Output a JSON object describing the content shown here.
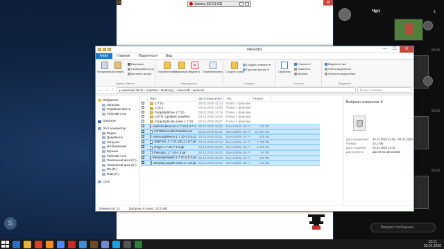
{
  "recording": {
    "label": "Запись [00:21:03]"
  },
  "explorer": {
    "title": "versions",
    "window_controls": {
      "minimize": "—",
      "maximize": "☐",
      "close": "✕"
    },
    "tabs": [
      "Файл",
      "Главная",
      "Поделиться",
      "Вид"
    ],
    "ribbon": {
      "copy": "Копировать",
      "paste": "Вставить",
      "cut": "Вырезать",
      "copy_path": "Скопировать путь",
      "paste_shortcut": "Вставить ярлык",
      "clipboard_group": "Буфер обмена",
      "move_to": "Переместить в",
      "copy_to": "Копировать в",
      "delete": "Удалить",
      "rename": "Переименовать",
      "organize_group": "Упорядочить",
      "new_folder": "Создать папку",
      "new_item": "Создать элемент ▾",
      "easy_access": "Простой доступ ▾",
      "create_group": "Создать",
      "properties": "Свойства",
      "open": "Открыть ▾",
      "edit": "Изменить",
      "history": "Журнал",
      "open_group": "Открыть",
      "select_all": "Выделить все",
      "select_none": "Снять выделение",
      "invert_selection": "Обратить выделение",
      "select_group": "Выделить"
    },
    "address": {
      "back": "←",
      "forward": "→",
      "up": "↑",
      "path": "▸ Никиткай Яков › AppData › Roaming › .minecraft › versions",
      "search_placeholder": "Поиск: versions"
    },
    "nav": [
      "Избранное",
      "Загрузки",
      "Недавние места",
      "Рабочий стол",
      "",
      "OneDrive",
      "",
      "Этот компьютер",
      "Видео",
      "Документы",
      "Загрузки",
      "Изображения",
      "Музыка",
      "Рабочий стол",
      "Локальный диск (C:)",
      "Локальный диск (D:)",
      "DS (E:)",
      "Data (F:)",
      "",
      "Сеть"
    ],
    "columns": [
      "Имя",
      "Дата изменения",
      "Тип",
      "Размер"
    ],
    "files": [
      {
        "name": "1.7.10",
        "date": "03.01.2020 12:13",
        "type": "Папка с файлами",
        "size": "",
        "kind": "folder",
        "selected": false
      },
      {
        "name": "1.15.1",
        "date": "03.01.2020 11:08",
        "type": "Папка с файлами",
        "size": "",
        "kind": "folder",
        "selected": false
      },
      {
        "name": "ForgeOptiFine 1.7.10",
        "date": "03.01.2020 12:15",
        "type": "Папка с файлами",
        "size": "",
        "kind": "folder",
        "selected": false
      },
      {
        "name": "LOTR_Updated_engFiles",
        "date": "03.12.2019 12:52",
        "type": "Папка с файлами",
        "size": "",
        "kind": "folder",
        "selected": false
      },
      {
        "name": "ForgeOptiLiteLoader 1.7.10",
        "date": "03.12.2019 19:27",
        "type": "Папка с файлами",
        "size": "",
        "kind": "folder",
        "selected": false
      },
      {
        "name": "codechickencore-1.7.10-1.0.7.47-univ...",
        "date": "28.10.2019 16:01",
        "type": "Executable Jar File",
        "size": "183 КБ",
        "kind": "jar",
        "selected": true
      },
      {
        "name": "LOTRMod-v35-Rebalum.jar",
        "date": "26.11.2019 11:25",
        "type": "Executable Jar File",
        "size": "21 254 КБ",
        "kind": "jar",
        "selected": true
      },
      {
        "name": "notenoughitems-1.7.10-1.0.5.120-univ...",
        "date": "28.10.2019 16:01",
        "type": "Executable Jar File",
        "size": "346 КБ",
        "kind": "jar",
        "selected": true
      },
      {
        "name": "OptiFine_1.7.10_HD_U_E7.jar",
        "date": "03.01.2020 12:14",
        "type": "Executable Jar File",
        "size": "1 798 КБ",
        "kind": "jar",
        "selected": true
      },
      {
        "name": "Origin-1.7.10-7.1.0.jar",
        "date": "26.10.2019 16:04",
        "type": "Executable Jar File",
        "size": "1 066 КБ",
        "kind": "jar",
        "selected": true
      },
      {
        "name": "thincaps_1.7.10-1.4.jar",
        "date": "26.10.2019 16:04",
        "type": "Executable Jar File",
        "size": "97 КБ",
        "kind": "jar",
        "selected": true
      },
      {
        "name": "WeepingAngels-1.7.10-4.0.2.jar",
        "date": "26.10.2019 16:04",
        "type": "Executable Jar File",
        "size": "253 КБ",
        "kind": "jar",
        "selected": true
      },
      {
        "name": "weeping-angels-mod-1.7.10.jar",
        "date": "03.01.2020 12:02",
        "type": "Executable Jar File",
        "size": "128 КБ",
        "kind": "jar",
        "selected": true
      }
    ],
    "details": {
      "header": "Выбрано элементов: 8",
      "rows": [
        {
          "k": "Дата изменения:",
          "v": "26.11.2015 11:25 – 03.01.2020 12:..."
        },
        {
          "k": "Размер:",
          "v": "23,1 МБ"
        },
        {
          "k": "Дата создания:",
          "v": "03.01.2020 12:12"
        },
        {
          "k": "Доступность:",
          "v": "Доступно автономно"
        }
      ]
    },
    "status": {
      "count": "Элементов: 13",
      "selected": "Выбрано 8 элем.: 23,1 МБ"
    }
  },
  "chat": {
    "title": "Чат",
    "download_icon": "download-icon",
    "timestamps": [
      "18:23",
      "18:23",
      "18:23"
    ],
    "input_placeholder": "Введите сообщение..."
  },
  "tray": {
    "time": "13:11",
    "date": "03.01.2020"
  },
  "colors": {
    "accent": "#1979ca",
    "selection": "#cce8ff",
    "close": "#c94a3a"
  }
}
